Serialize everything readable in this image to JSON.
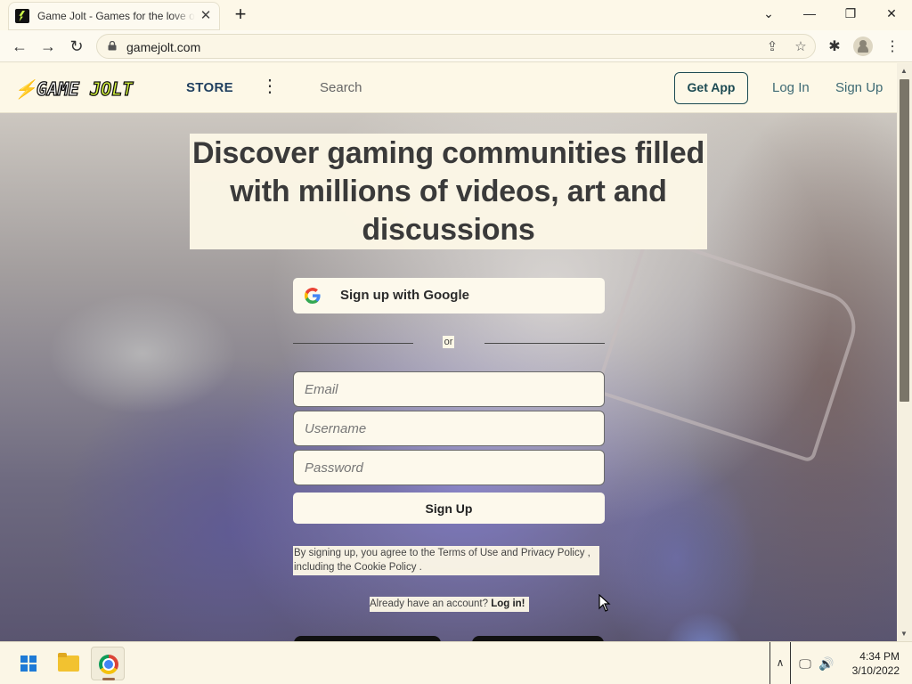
{
  "browser": {
    "tab_title": "Game Jolt - Games for the love of",
    "url": "gamejolt.com"
  },
  "header": {
    "logo_game": "GAME",
    "logo_jolt": "JOLT",
    "store": "STORE",
    "search_placeholder": "Search",
    "get_app": "Get App",
    "log_in": "Log In",
    "sign_up": "Sign Up"
  },
  "hero": {
    "headline": "Discover gaming communities filled with millions of videos, art and discussions",
    "google_button": "Sign up with Google",
    "or": "or",
    "email_placeholder": "Email",
    "username_placeholder": "Username",
    "password_placeholder": "Password",
    "signup_button": "Sign Up",
    "terms_prefix": "By signing up, you agree to the ",
    "terms_link": "Terms of Use",
    "terms_and": " and ",
    "privacy_link": "Privacy Policy",
    "terms_mid": " , including the ",
    "cookie_link": "Cookie Policy",
    "terms_end": " .",
    "already_text": "Already have an account? ",
    "login_link": "Log in!"
  },
  "taskbar": {
    "time": "4:34 PM",
    "date": "3/10/2022"
  }
}
